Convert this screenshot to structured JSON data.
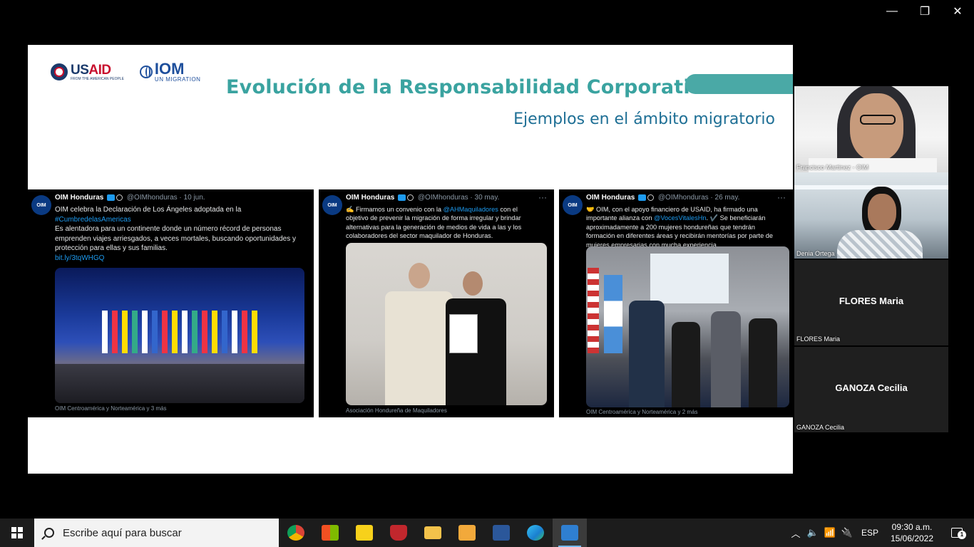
{
  "window": {
    "minimize_glyph": "—",
    "restore_glyph": "❐",
    "close_glyph": "✕"
  },
  "slide": {
    "logos": {
      "usaid_a": "US",
      "usaid_b": "AID",
      "usaid_sub": "FROM THE AMERICAN PEOPLE",
      "iom_name": "IOM",
      "iom_tag": "UN MIGRATION"
    },
    "title": "Evolución de la  Responsabilidad Corporativa",
    "subtitle": "Ejemplos en el ámbito migratorio",
    "accent_color": "#3aa3a0",
    "tweets": [
      {
        "avatar": "OIM",
        "account": "OIM Honduras",
        "handle": "@OIMhonduras · 10 jun.",
        "line1": "OIM celebra la Declaración de Los Ángeles adoptada en la",
        "hashtag": "#CumbredelasAmericas",
        "line2": "Es alentadora para un continente donde un número récord de personas emprenden viajes arriesgados, a veces mortales, buscando oportunidades y protección para ellas y sus familias.",
        "link": "bit.ly/3tqWHGQ",
        "caption": "OIM Centroamérica y Norteamérica y 3 más"
      },
      {
        "avatar": "OIM",
        "account": "OIM Honduras",
        "handle": "@OIMhonduras · 30 may.",
        "pre": "✍️ Firmamos un convenio con la ",
        "mention": "@AHMaquiladores",
        "post": " con el objetivo de prevenir la migración de forma irregular y brindar alternativas para la generación de medios de vida a las y los colaboradores del sector maquilador de Honduras.",
        "caption": "Asociación Hondureña de Maquiladores"
      },
      {
        "avatar": "OIM",
        "account": "OIM Honduras",
        "handle": "@OIMhonduras · 26 may.",
        "pre": "🤝 OIM, con el apoyo financiero de USAID, ha firmado una importante alianza con ",
        "mention": "@VocesVitalesHn",
        "post": ". ✔️ Se beneficiarán aproximadamente a 200 mujeres hondureñas que tendrán formación en diferentes áreas y recibirán mentorías por parte de mujeres empresarias con mucha experiencia.",
        "caption": "OIM Centroamérica y Norteamérica y 2 más"
      }
    ]
  },
  "participants": [
    {
      "label": "Francisco Martinez - OIM"
    },
    {
      "label": "Denia Ortega"
    },
    {
      "name": "FLORES Maria",
      "label": "FLORES Maria"
    },
    {
      "name": "GANOZA Cecilia",
      "label": "GANOZA Cecilia"
    }
  ],
  "taskbar": {
    "search_placeholder": "Escribe aquí para buscar",
    "apps": [
      {
        "name": "chrome-icon",
        "color": "#db4437"
      },
      {
        "name": "store-icon",
        "color": "#0078d4"
      },
      {
        "name": "sticky-notes-icon",
        "color": "#f7d11b"
      },
      {
        "name": "security-app-icon",
        "color": "#c1272d"
      },
      {
        "name": "file-explorer-icon",
        "color": "#f3c24b"
      },
      {
        "name": "outlook-icon",
        "color": "#f2a93b"
      },
      {
        "name": "word-icon",
        "color": "#2b579a"
      },
      {
        "name": "edge-icon",
        "color": "#1a9bd7"
      },
      {
        "name": "meeting-app-icon",
        "color": "#2f7fd1"
      }
    ],
    "language": "ESP",
    "time": "09:30 a.m.",
    "date": "15/06/2022",
    "notifications": "1"
  }
}
